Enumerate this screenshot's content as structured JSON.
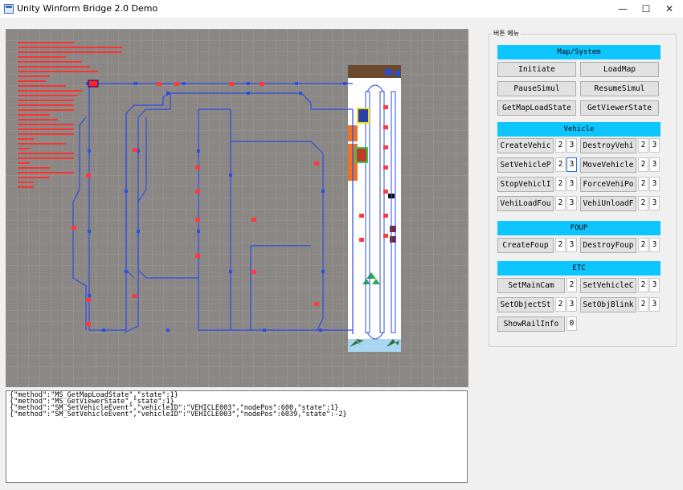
{
  "window": {
    "title": "Unity Winform Bridge 2.0 Demo",
    "minimize": "—",
    "maximize": "☐",
    "close": "✕"
  },
  "log_lines": [
    "{\"method\":\"MS_GetMapLoadState\",\"state\":1}",
    "{\"method\":\"MS_GetViewerState\",\"state\":1}",
    "{\"method\":\"SM_SetVehicleEvent\",\"vehicleID\":\"VEHICLE003\",\"nodePos\":600,\"state\":1}",
    "{\"method\":\"SM_SetVehicleEvent\",\"vehicleID\":\"VEHICLE003\",\"nodePos\":6039,\"state\":-2}"
  ],
  "panel": {
    "group_label": "버튼 메뉴",
    "map_system": {
      "header": "Map/System",
      "buttons": [
        "Initiate",
        "LoadMap",
        "PauseSimul",
        "ResumeSimul",
        "GetMapLoadState",
        "GetViewerState"
      ]
    },
    "vehicle": {
      "header": "Vehicle",
      "rows": [
        {
          "left": "CreateVehic",
          "l1": "2",
          "l2": "3",
          "right": "DestroyVehi",
          "r1": "2",
          "r2": "3"
        },
        {
          "left": "SetVehicleP",
          "l1": "2",
          "l2": "3",
          "right": "MoveVehicle",
          "r1": "2",
          "r2": "3"
        },
        {
          "left": "StopVehiclI",
          "l1": "2",
          "l2": "3",
          "right": "ForceVehiPo",
          "r1": "2",
          "r2": "3"
        },
        {
          "left": "VehiLoadFou",
          "l1": "2",
          "l2": "3",
          "right": "VehiUnloadF",
          "r1": "2",
          "r2": "3"
        }
      ]
    },
    "foup": {
      "header": "FOUP",
      "row": {
        "left": "CreateFoup",
        "l1": "2",
        "l2": "3",
        "right": "DestroyFoup",
        "r1": "2",
        "r2": "3"
      }
    },
    "etc": {
      "header": "ETC",
      "rows": [
        {
          "left": "SetMainCam",
          "l1": "2",
          "right": "SetVehicleC",
          "r1": "2",
          "r2": "3"
        },
        {
          "left": "SetObjectSt",
          "l1": "2",
          "l2": "3",
          "right": "SetObjBlink",
          "r1": "2",
          "r2": "3"
        }
      ],
      "last": {
        "label": "ShowRailInfo",
        "value": "0"
      }
    }
  },
  "colors": {
    "accent": "#0ec6ff",
    "rail": "#2b4de8",
    "viewport_bg": "#8b8785"
  }
}
